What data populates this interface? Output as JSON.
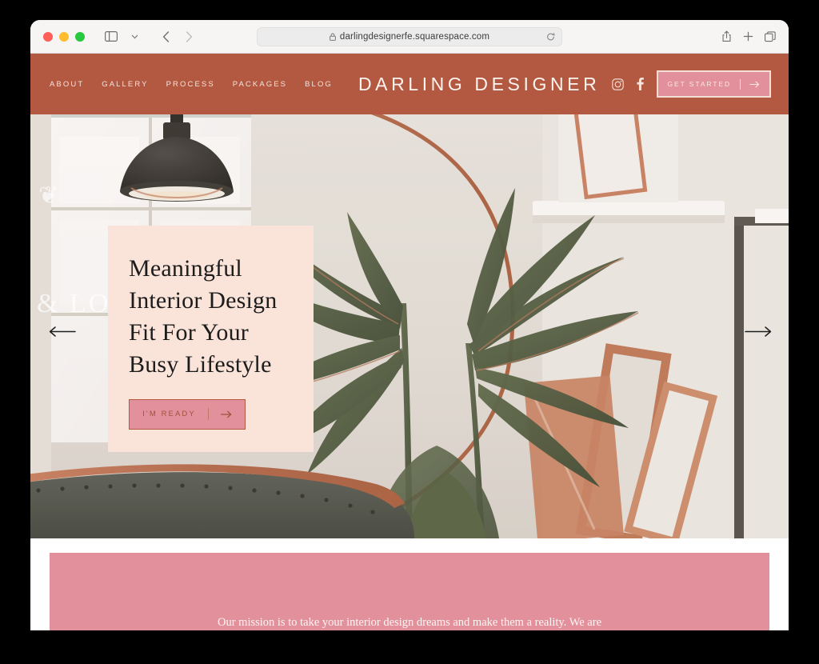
{
  "browser": {
    "url": "darlingdesignerfe.squarespace.com",
    "lock_icon": "lock-icon",
    "reload_icon": "reload-icon",
    "sidebar_icon": "sidebar-toggle-icon",
    "tab_overview_chevron": "chevron-down-icon",
    "back_icon": "back-arrow-icon",
    "forward_icon": "forward-arrow-icon",
    "share_icon": "share-icon",
    "newtab_icon": "plus-icon",
    "tabs_icon": "tabs-overview-icon",
    "traffic_lights": [
      "close-red",
      "minimize-yellow",
      "maximize-green"
    ]
  },
  "site": {
    "brand": "DARLING DESIGNER",
    "nav": [
      {
        "label": "ABOUT"
      },
      {
        "label": "GALLERY"
      },
      {
        "label": "PROCESS"
      },
      {
        "label": "PACKAGES"
      },
      {
        "label": "BLOG"
      }
    ],
    "social": [
      {
        "name": "instagram-icon"
      },
      {
        "name": "facebook-icon"
      }
    ],
    "cta": {
      "label": "GET STARTED",
      "arrow": "arrow-right-icon"
    },
    "colors": {
      "nav_bg": "#b35941",
      "pink": "#e2909b",
      "cream": "#fae3d8",
      "nav_text": "#f4e4de"
    }
  },
  "hero": {
    "heading": "Meaningful\nInterior Design\nFit For Your\nBusy Lifestyle",
    "button": {
      "label": "I'M READY",
      "arrow": "arrow-right-icon"
    },
    "watermark": "& LOCA",
    "prev_arrow": "arrow-left-icon",
    "next_arrow": "arrow-right-icon",
    "image_alt": "Interior room with palm plant, pendant lamp, round mirror and leaning picture frames"
  },
  "mission": {
    "text": "Our mission is to take your interior design dreams and make them a reality. We are"
  }
}
